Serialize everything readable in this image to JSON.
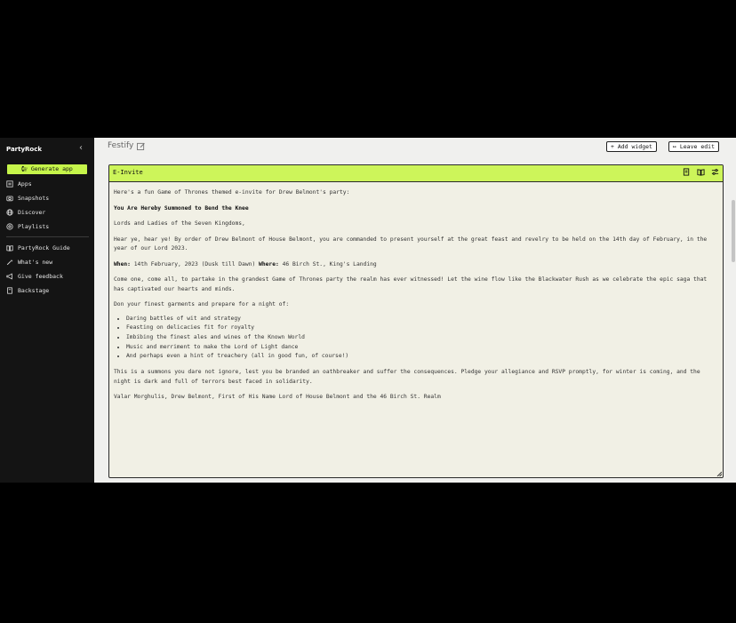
{
  "sidebar": {
    "brand": "PartyRock",
    "generate_label": "Generate app",
    "items": [
      {
        "label": "Apps",
        "icon": "apps-icon"
      },
      {
        "label": "Snapshots",
        "icon": "snapshot-icon"
      },
      {
        "label": "Discover",
        "icon": "globe-icon"
      },
      {
        "label": "Playlists",
        "icon": "playlist-icon"
      }
    ],
    "items2": [
      {
        "label": "PartyRock Guide",
        "icon": "book-icon"
      },
      {
        "label": "What's new",
        "icon": "sparkle-icon"
      },
      {
        "label": "Give feedback",
        "icon": "megaphone-icon"
      },
      {
        "label": "Backstage",
        "icon": "document-icon"
      }
    ]
  },
  "header": {
    "app_title": "Festify",
    "add_widget": "+ Add widget",
    "leave_edit": "Leave edit"
  },
  "widget": {
    "title": "E-Invite",
    "intro": "Here's a fun Game of Thrones themed e-invite for Drew Belmont's party:",
    "heading": "You Are Hereby Summoned to Bend the Knee",
    "greeting": "Lords and Ladies of the Seven Kingdoms,",
    "para1": "Hear ye, hear ye! By order of Drew Belmont of House Belmont, you are commanded to present yourself at the great feast and revelry to be held on the 14th day of February, in the year of our Lord 2023.",
    "when_label": "When:",
    "when_value": " 14th February, 2023 (Dusk till Dawn) ",
    "where_label": "Where:",
    "where_value": " 46 Birch St., King's Landing",
    "para2": "Come one, come all, to partake in the grandest Game of Thrones party the realm has ever witnessed! Let the wine flow like the Blackwater Rush as we celebrate the epic saga that has captivated our hearts and minds.",
    "list_intro": "Don your finest garments and prepare for a night of:",
    "list": [
      "Daring battles of wit and strategy",
      "Feasting on delicacies fit for royalty",
      "Imbibing the finest ales and wines of the Known World",
      "Music and merriment to make the Lord of Light dance",
      "And perhaps even a hint of treachery (all in good fun, of course!)"
    ],
    "para3": "This is a summons you dare not ignore, lest you be branded an oathbreaker and suffer the consequences. Pledge your allegiance and RSVP promptly, for winter is coming, and the night is dark and full of terrors best faced in solidarity.",
    "signoff": "Valar Morghulis, Drew Belmont, First of His Name Lord of House Belmont and the 46 Birch St. Realm"
  },
  "colors": {
    "accent": "#c6f54a",
    "sidebar_bg": "#141414",
    "widget_bg": "#f1f0e5"
  }
}
